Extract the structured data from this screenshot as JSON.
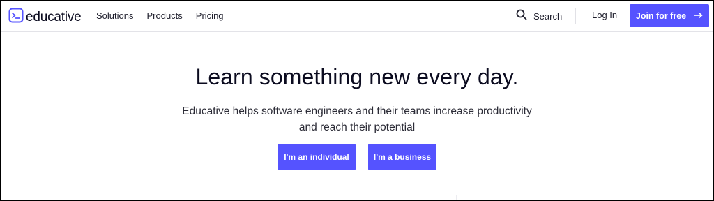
{
  "brand": {
    "name": "educative",
    "accent": "#5553ff"
  },
  "nav": {
    "links": [
      "Solutions",
      "Products",
      "Pricing"
    ],
    "search_label": "Search",
    "login_label": "Log In",
    "join_label": "Join for free"
  },
  "hero": {
    "title": "Learn something new every day.",
    "subtitle": "Educative helps software engineers and their teams increase productivity and reach their potential",
    "cta_individual": "I'm an individual",
    "cta_business": "I'm a business"
  },
  "icons": [
    "terminal-logo-icon",
    "search-icon",
    "arrow-right-icon"
  ]
}
